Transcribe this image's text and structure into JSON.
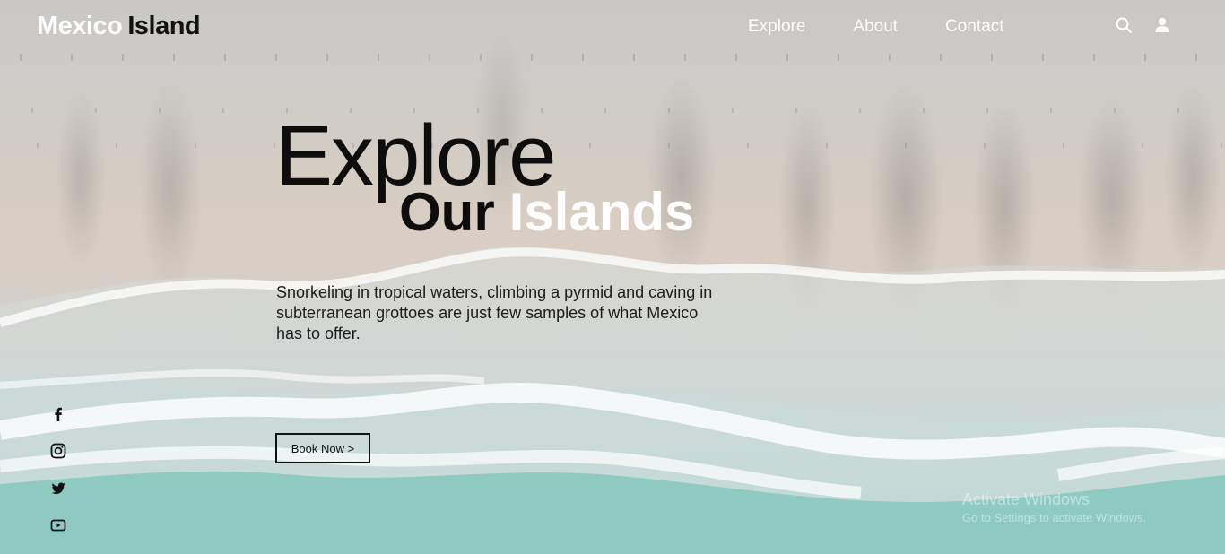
{
  "brand": {
    "logo_part1": "Mexico",
    "logo_part2": "Island"
  },
  "nav": {
    "items": [
      {
        "label": "Explore"
      },
      {
        "label": "About"
      },
      {
        "label": "Contact"
      }
    ]
  },
  "header_icons": [
    "search-icon",
    "user-icon"
  ],
  "hero": {
    "title": "Explore",
    "subtitle_dark": "Our",
    "subtitle_light": "Islands",
    "description": "Snorkeling in tropical waters, climbing a pyrmid and caving in subterranean grottoes are just few samples of what Mexico has to offer.",
    "cta_label": "Book Now >"
  },
  "social_icons": [
    "facebook-icon",
    "instagram-icon",
    "twitter-icon",
    "youtube-icon"
  ],
  "watermark": {
    "line1": "Activate Windows",
    "line2": "Go to Settings to activate Windows."
  },
  "colors": {
    "logo_light": "#ffffff",
    "logo_dark": "#111111",
    "title_dark": "#0d0d0d",
    "nav_text": "#ffffff",
    "sea": "#74bdb3",
    "sand": "#d9cec4"
  }
}
